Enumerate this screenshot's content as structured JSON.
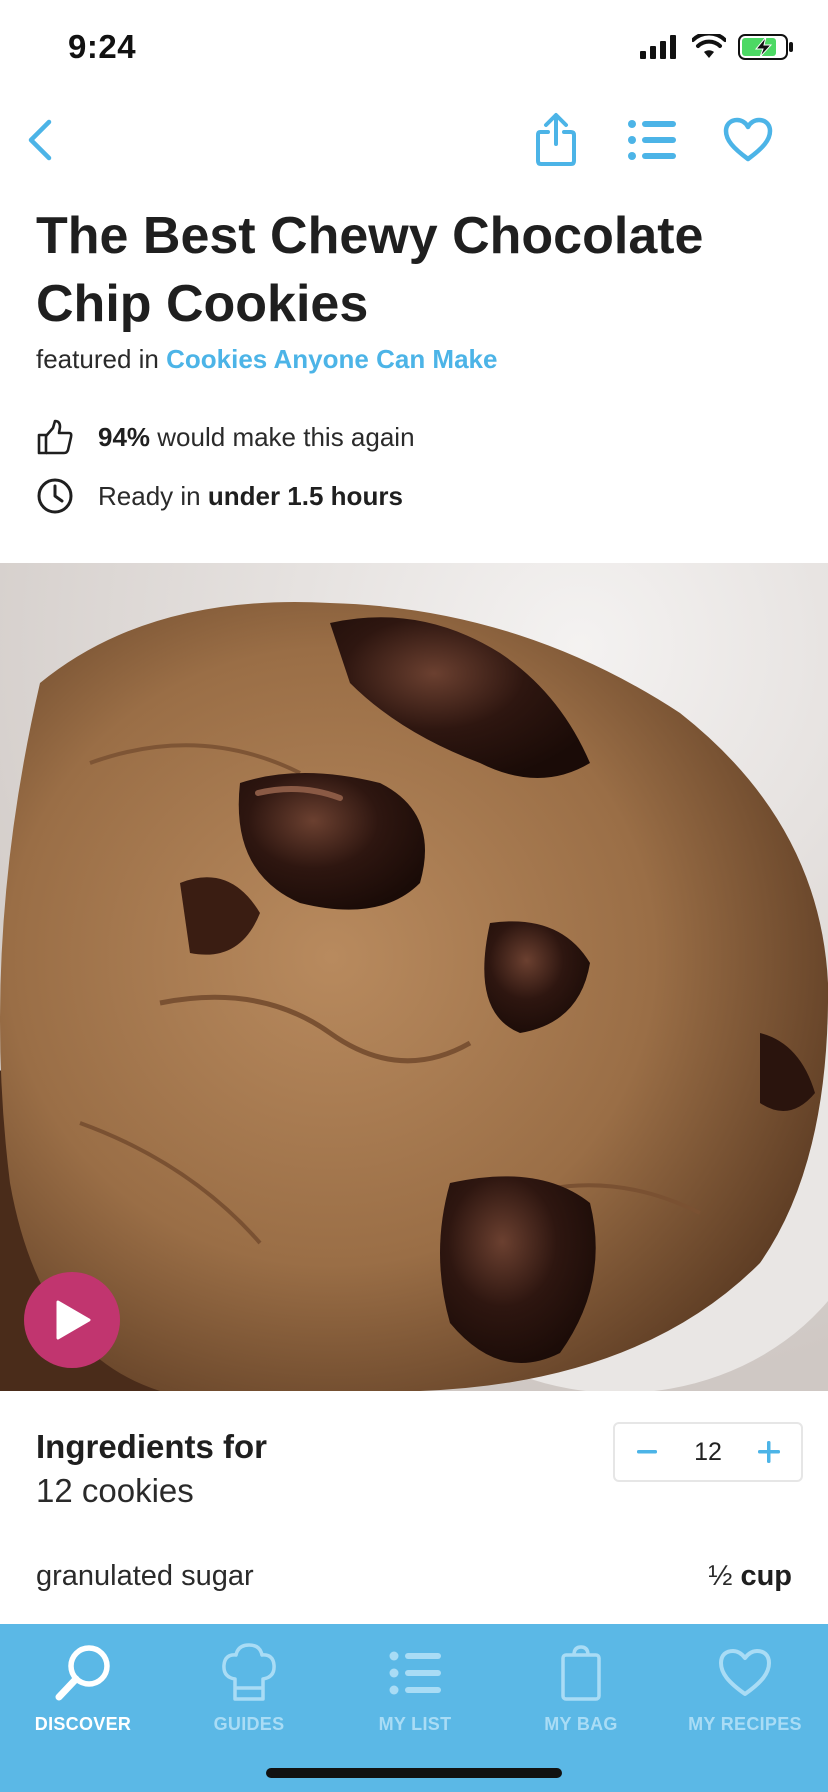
{
  "status": {
    "time": "9:24"
  },
  "colors": {
    "accent": "#4cb4e7",
    "tab_bar": "#5bb8e6",
    "play_button": "#c1356f"
  },
  "recipe": {
    "title": "The Best Chewy Chocolate Chip Cookies",
    "featured_prefix": "featured in",
    "featured_link": "Cookies Anyone Can Make",
    "rating_percent": "94%",
    "rating_text": "would make this again",
    "ready_prefix": "Ready in",
    "ready_time": "under 1.5 hours"
  },
  "ingredients": {
    "title": "Ingredients for",
    "servings_text": "12 cookies",
    "servings_value": "12",
    "items": [
      {
        "name": "granulated sugar",
        "amount": "½",
        "unit": "cup"
      }
    ]
  },
  "tabs": [
    {
      "label": "DISCOVER",
      "icon": "search-icon",
      "active": true
    },
    {
      "label": "GUIDES",
      "icon": "chef-hat-icon",
      "active": false
    },
    {
      "label": "MY LIST",
      "icon": "list-icon",
      "active": false
    },
    {
      "label": "MY BAG",
      "icon": "bag-icon",
      "active": false
    },
    {
      "label": "MY RECIPES",
      "icon": "heart-icon",
      "active": false
    }
  ]
}
